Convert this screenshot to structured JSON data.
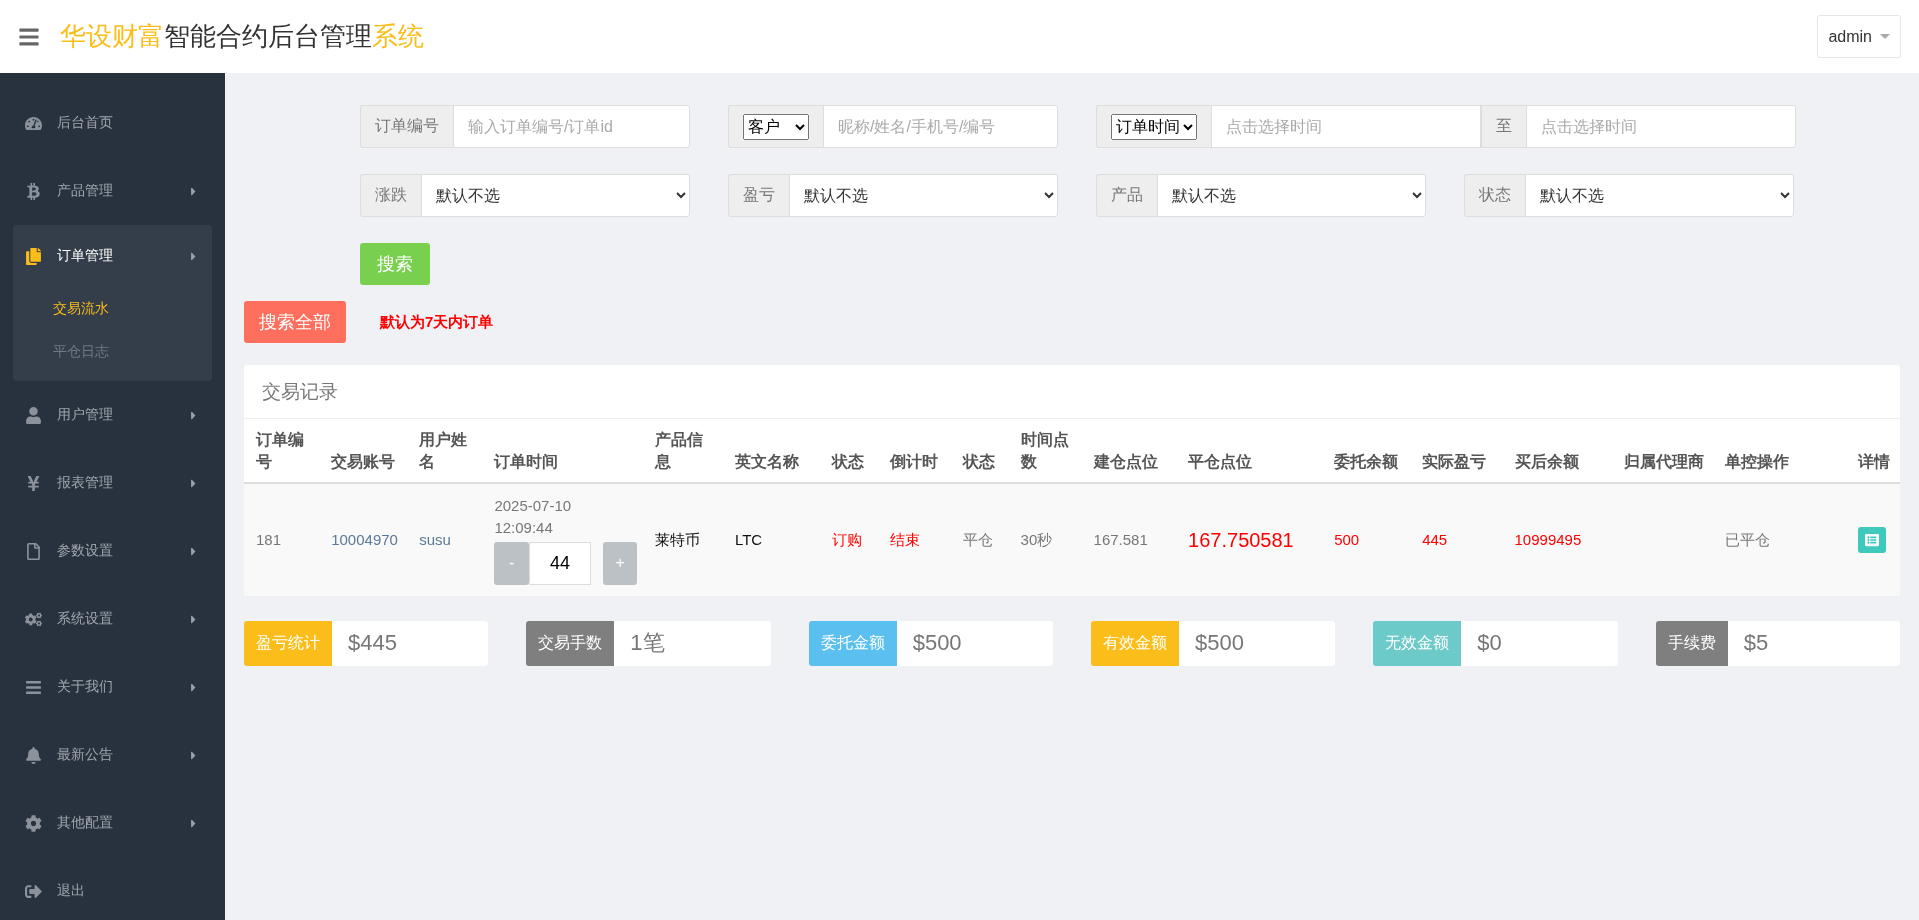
{
  "header": {
    "title_parts": [
      {
        "text": "华设财富",
        "accent": true
      },
      {
        "text": "智能合约后台管理",
        "accent": false
      },
      {
        "text": "系统",
        "accent": true
      }
    ],
    "user": "admin"
  },
  "sidebar": {
    "items": [
      {
        "label": "后台首页",
        "selected": false,
        "has_arrow": false
      },
      {
        "label": "产品管理",
        "selected": false,
        "has_arrow": true
      },
      {
        "label": "订单管理",
        "selected": true,
        "has_arrow": true,
        "expanded": true,
        "children": [
          {
            "label": "交易流水",
            "selected": true
          },
          {
            "label": "平仓日志",
            "selected": false
          }
        ]
      },
      {
        "label": "用户管理",
        "selected": false,
        "has_arrow": true
      },
      {
        "label": "报表管理",
        "selected": false,
        "has_arrow": true
      },
      {
        "label": "参数设置",
        "selected": false,
        "has_arrow": true
      },
      {
        "label": "系统设置",
        "selected": false,
        "has_arrow": true
      },
      {
        "label": "关于我们",
        "selected": false,
        "has_arrow": true
      },
      {
        "label": "最新公告",
        "selected": false,
        "has_arrow": true
      },
      {
        "label": "其他配置",
        "selected": false,
        "has_arrow": true
      },
      {
        "label": "退出",
        "selected": false,
        "has_arrow": false
      }
    ]
  },
  "filters": {
    "order_no": {
      "label": "订单编号",
      "placeholder": "输入订单编号/订单id"
    },
    "customer": {
      "select_value": "客户",
      "placeholder": "昵称/姓名/手机号/编号"
    },
    "time": {
      "select_value": "订单时间",
      "placeholder": "点击选择时间",
      "separator": "至",
      "end_placeholder": "点击选择时间"
    },
    "selects": [
      {
        "label": "涨跌",
        "value": "默认不选"
      },
      {
        "label": "盈亏",
        "value": "默认不选"
      },
      {
        "label": "产品",
        "value": "默认不选"
      },
      {
        "label": "状态",
        "value": "默认不选"
      }
    ],
    "search_button": "搜索",
    "search_all_button": "搜索全部",
    "note": "默认为7天内订单"
  },
  "table": {
    "title": "交易记录",
    "columns": [
      "订单编号",
      "交易账号",
      "用户姓名",
      "订单时间",
      "产品信息",
      "英文名称",
      "状态",
      "倒计时",
      "状态",
      "时间点数",
      "建仓点位",
      "平仓点位",
      "委托余额",
      "实际盈亏",
      "买后余额",
      "归属代理商",
      "单控操作",
      "详情"
    ],
    "rows": [
      {
        "cells": [
          {
            "kind": "plain",
            "text": "181"
          },
          {
            "kind": "link",
            "text": "10004970"
          },
          {
            "kind": "link",
            "text": "susu"
          },
          {
            "kind": "time",
            "date": "2025-07-10",
            "time": "12:09:44",
            "minus": "-",
            "value": "44",
            "plus": "+"
          },
          {
            "kind": "dark",
            "text": "莱特币"
          },
          {
            "kind": "dark",
            "text": "LTC"
          },
          {
            "kind": "alert",
            "text": "订购"
          },
          {
            "kind": "alert",
            "text": "结束"
          },
          {
            "kind": "plain",
            "text": "平仓"
          },
          {
            "kind": "plain",
            "text": "30秒"
          },
          {
            "kind": "plain",
            "text": "167.581"
          },
          {
            "kind": "big_alert",
            "text": "167.750581"
          },
          {
            "kind": "alert",
            "text": "500"
          },
          {
            "kind": "alert",
            "text": "445"
          },
          {
            "kind": "alert",
            "text": "10999495"
          },
          {
            "kind": "empty"
          },
          {
            "kind": "plain",
            "text": "已平仓"
          },
          {
            "kind": "detail"
          }
        ]
      }
    ]
  },
  "summary": [
    {
      "label": "盈亏统计",
      "value": "$445",
      "color": "#fbbd19"
    },
    {
      "label": "交易手数",
      "value": "1笔",
      "color": "#7f7f7f"
    },
    {
      "label": "委托金额",
      "value": "$500",
      "color": "#5bc0f0"
    },
    {
      "label": "有效金额",
      "value": "$500",
      "color": "#fbbd19"
    },
    {
      "label": "无效金额",
      "value": "$0",
      "color": "#6ccac9"
    },
    {
      "label": "手续费",
      "value": "$5",
      "color": "#7f7f7f"
    }
  ]
}
